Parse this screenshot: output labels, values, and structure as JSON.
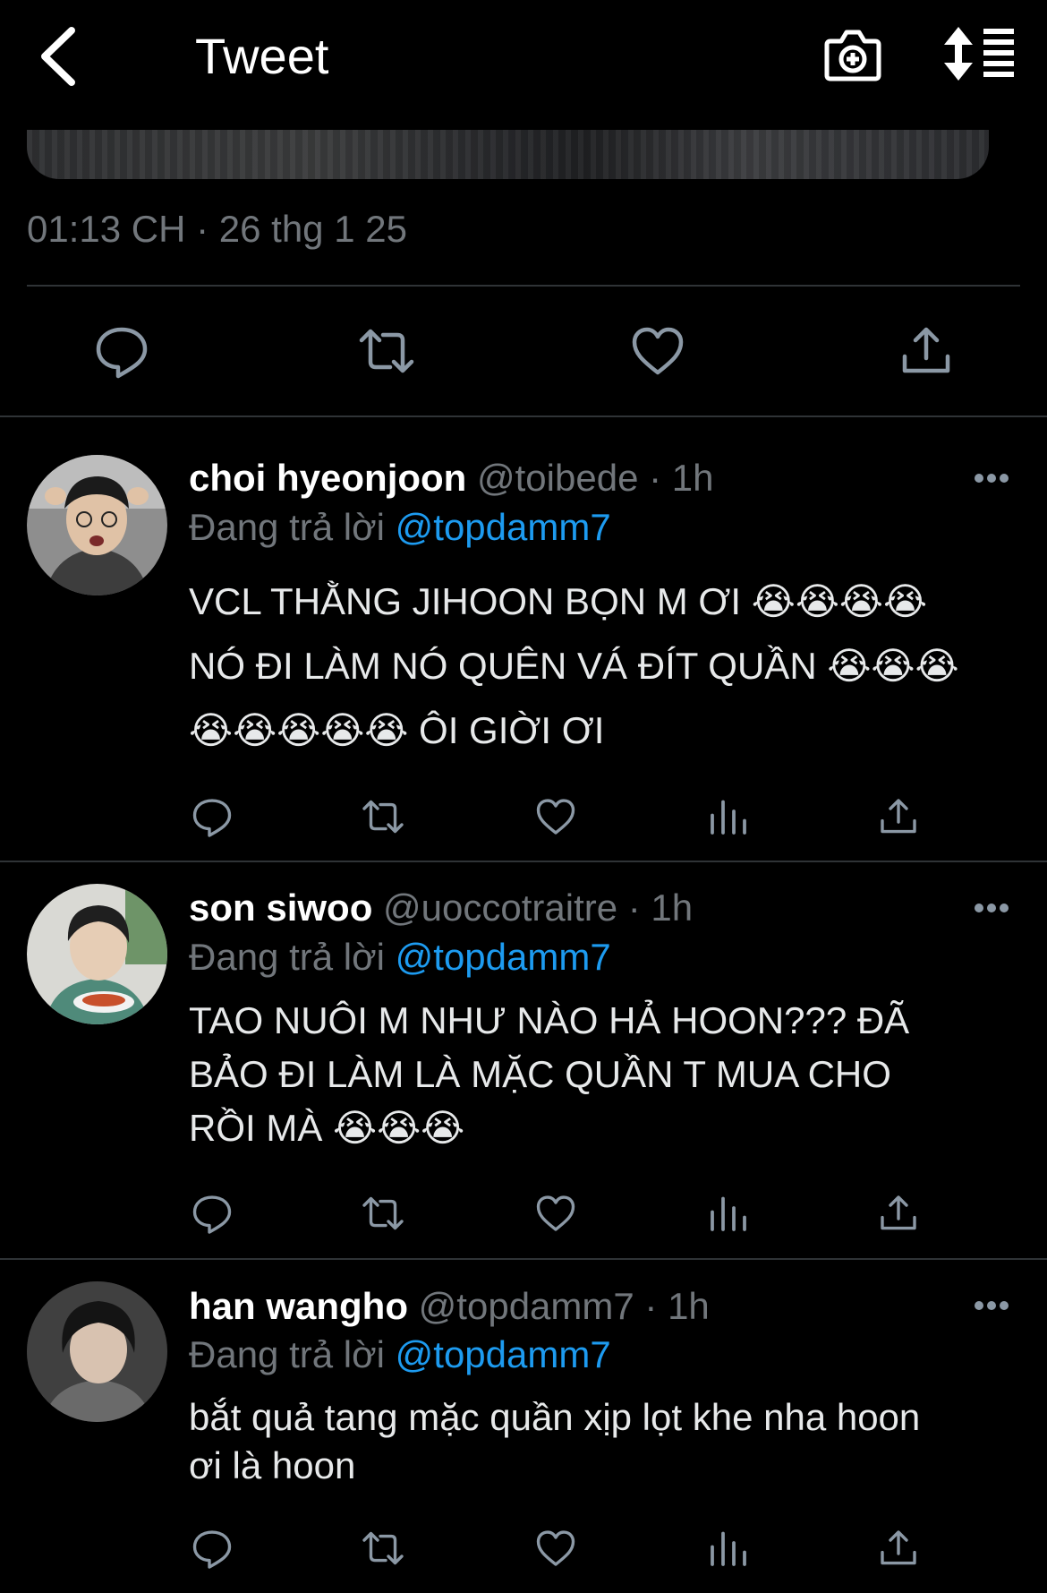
{
  "header": {
    "title": "Tweet",
    "back_icon": "chevron-left-icon",
    "camera_icon": "camera-plus-icon",
    "sort_icon": "sort-list-icon"
  },
  "tweet": {
    "timestamp": "01:13 CH · 26 thg 1 25",
    "actions": [
      "reply-icon",
      "retweet-icon",
      "like-icon",
      "share-icon"
    ]
  },
  "replies": [
    {
      "name": "choi hyeonjoon",
      "handle": "@toibede",
      "time": "· 1h",
      "replying_prefix": "Đang trả lời",
      "replying_to": "@topdamm7",
      "text": "VCL THẰNG JIHOON BỌN M ƠI 😭😭😭😭\nNÓ ĐI LÀM NÓ QUÊN VÁ ĐÍT QUẦN 😭😭😭\n😭😭😭😭😭  ÔI GIỜI ƠI"
    },
    {
      "name": "son siwoo",
      "handle": "@uoccotraitre",
      "time": "· 1h",
      "replying_prefix": "Đang trả lời",
      "replying_to": "@topdamm7",
      "text": "TAO NUÔI M NHƯ NÀO HẢ HOON??? ĐÃ\nBẢO ĐI LÀM LÀ MẶC QUẦN T MUA CHO\nRỒI MÀ 😭😭😭"
    },
    {
      "name": "han wangho",
      "handle": "@topdamm7",
      "time": "· 1h",
      "replying_prefix": "Đang trả lời",
      "replying_to": "@topdamm7",
      "text": "bắt quả tang mặc quần xịp lọt khe nha hoon\nơi là hoon"
    }
  ],
  "colors": {
    "background": "#000000",
    "text": "#e7e9ea",
    "secondary": "#71767b",
    "accent": "#1d9bf0",
    "divider": "#2f3336"
  }
}
